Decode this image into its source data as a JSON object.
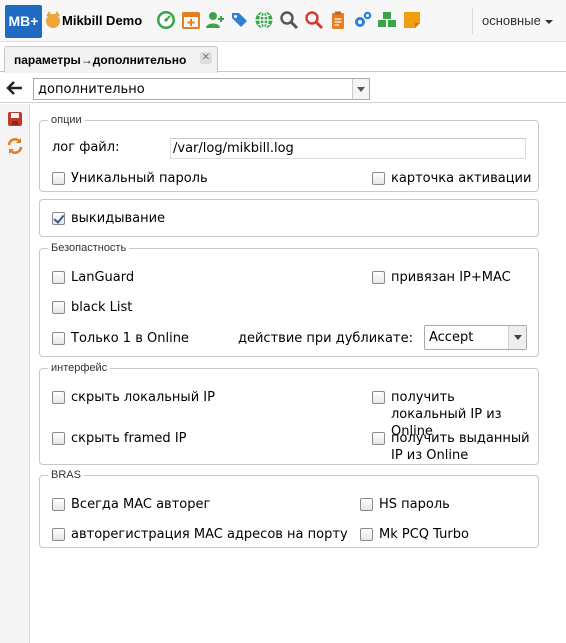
{
  "app": {
    "logo": "MB+",
    "title": "Mikbill Demo",
    "menu_label": "основные"
  },
  "toolbar_icons": [
    "dashboard-icon",
    "calendar-add-icon",
    "user-add-icon",
    "tags-icon",
    "globe-icon",
    "search-icon",
    "search-red-icon",
    "clipboard-icon",
    "settings-icon",
    "cubes-icon",
    "sticky-note-icon"
  ],
  "tab": {
    "label": "параметры→дополнительно",
    "close": "✕"
  },
  "nav": {
    "selected": "дополнительно"
  },
  "options": {
    "legend": "опции",
    "logfile_label": "лог файл:",
    "logfile_value": "/var/log/mikbill.log",
    "unique_password": "Уникальный пароль",
    "activation_card": "карточка активации"
  },
  "kick": {
    "label": "выкидывание",
    "checked": true
  },
  "security": {
    "legend": "Безопастность",
    "languard": "LanGuard",
    "bound_ip_mac": "привязан IP+MAC",
    "blacklist": "black List",
    "only_one_online": "Только 1 в Online",
    "dup_action_label": "действие при дубликате:",
    "dup_action_value": "Accept"
  },
  "interface": {
    "legend": "интерфейс",
    "hide_local_ip": "скрыть локальный IP",
    "get_local_ip": "получить локальный IP из Online",
    "hide_framed_ip": "скрыть framed IP",
    "get_assigned_ip": "получить выданный IP из Online"
  },
  "bras": {
    "legend": "BRAS",
    "always_mac_autoreg": "Всегда MAC авторег",
    "hs_password": "HS пароль",
    "autoreg_mac_port": "авторегистрация MAC адресов на порту",
    "mk_pcq_turbo": "Mk PCQ Turbo"
  },
  "colors": {
    "brand_blue": "#1f6bc4",
    "save": "#c0392b",
    "refresh": "#e67e22"
  }
}
